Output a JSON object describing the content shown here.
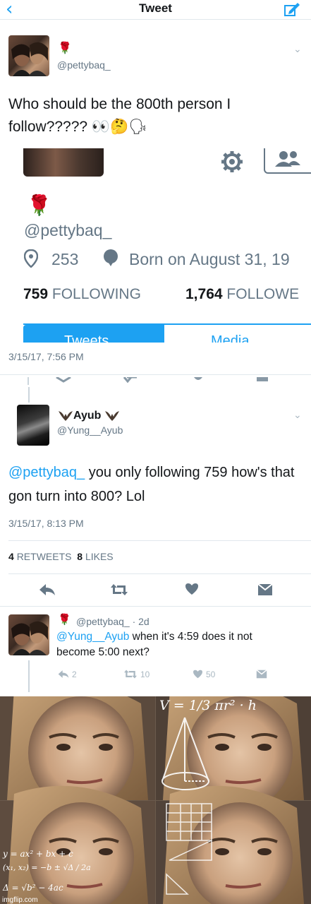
{
  "nav": {
    "title": "Tweet",
    "back_icon": "chevron-left-icon",
    "compose_icon": "compose-icon"
  },
  "tweet1": {
    "handle": "@pettybaq_",
    "text_line1": "Who should be the 800th person I",
    "text_line2": "follow????? 👀🤔🗣",
    "timestamp": "3/15/17, 7:56 PM",
    "embed": {
      "handle": "@pettybaq_",
      "location": "253",
      "born": "Born on August 31, 19",
      "following_count": "759",
      "following_label": "FOLLOWING",
      "followers_count": "1,764",
      "followers_label": "FOLLOWE",
      "tab_tweets": "Tweets",
      "tab_media": "Media"
    }
  },
  "tweet2": {
    "name": "Ayub",
    "handle": "@Yung__Ayub",
    "mention": "@pettybaq_",
    "text_after_mention": " you only following 759 how's that gon turn into 800? Lol",
    "timestamp": "3/15/17, 8:13 PM",
    "retweets_count": "4",
    "retweets_label": "RETWEETS",
    "likes_count": "8",
    "likes_label": "LIKES"
  },
  "tweet3": {
    "handle_time": "@pettybaq_ · 2d",
    "mention": "@Yung__Ayub",
    "text_line1_rest": " when it's 4:59 does it not",
    "text_line2": "become 5:00 next?",
    "replies": "2",
    "retweets": "10",
    "likes": "50"
  },
  "meme": {
    "formula_top": "V = 1/3 πr² · h",
    "formula_quad1": "y = ax² + bx + c",
    "formula_quad2": "(x₁, x₂) = −b ± √Δ / 2a",
    "formula_quad3": "Δ = √b² − 4ac",
    "watermark": "imgflip.com"
  },
  "colors": {
    "accent": "#1da1f2",
    "text": "#14171a",
    "secondary": "#657786",
    "divider": "#e1e8ed",
    "rose": "#c0142a"
  }
}
